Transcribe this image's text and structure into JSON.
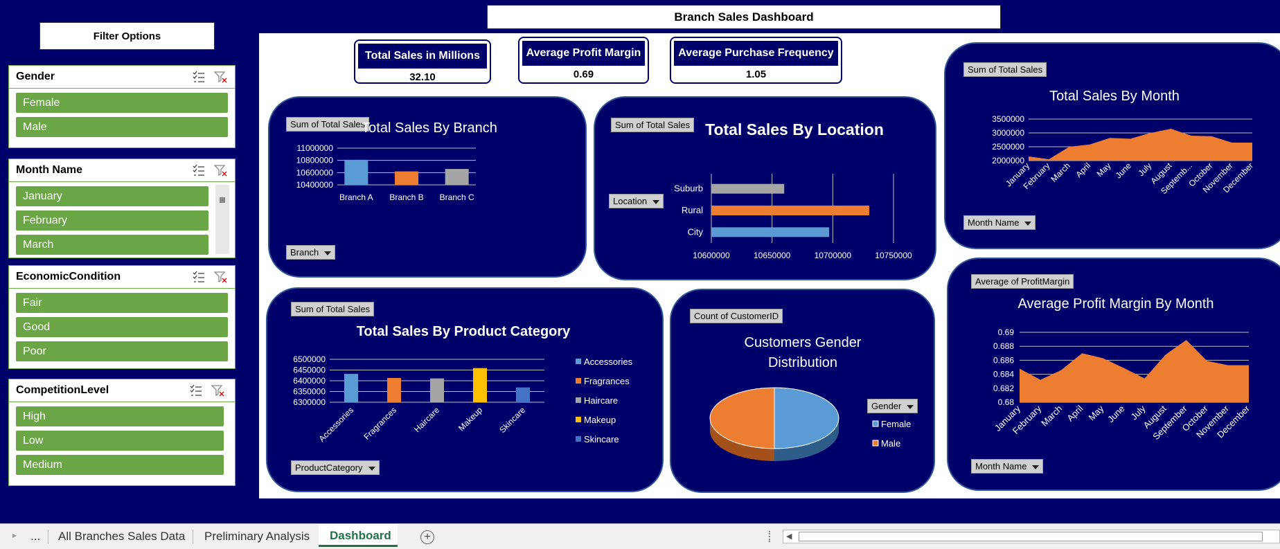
{
  "dashboard_title": "Branch Sales Dashboard",
  "filter_title": "Filter Options",
  "slicers": {
    "gender": {
      "title": "Gender",
      "items": [
        "Female",
        "Male"
      ]
    },
    "month": {
      "title": "Month Name",
      "items": [
        "January",
        "February",
        "March"
      ]
    },
    "economic": {
      "title": "EconomicCondition",
      "items": [
        "Fair",
        "Good",
        "Poor"
      ]
    },
    "competition": {
      "title": "CompetitionLevel",
      "items": [
        "High",
        "Low",
        "Medium"
      ]
    }
  },
  "kpis": [
    {
      "title": "Total Sales in Millions",
      "value": "32.10"
    },
    {
      "title": "Average Profit Margin",
      "value": "0.69"
    },
    {
      "title": "Average Purchase Frequency",
      "value": "1.05"
    }
  ],
  "field_buttons": {
    "branch_value": "Sum of Total Sales",
    "branch_axis": "Branch",
    "location_value": "Sum of Total Sales",
    "location_axis": "Location",
    "month_value": "Sum of Total Sales",
    "month_axis": "Month Name",
    "category_value": "Sum of Total Sales",
    "category_axis": "ProductCategory",
    "gender_value": "Count of CustomerID",
    "gender_axis": "Gender",
    "margin_value": "Average of ProfitMargin",
    "margin_axis": "Month Name"
  },
  "colors": {
    "navy": "#00006a",
    "blue": "#5b9bd5",
    "orange": "#ed7d31",
    "gray": "#a5a5a5",
    "yellow": "#ffc000",
    "darkblue": "#4472c4",
    "slicer_green": "#6aa645"
  },
  "tabs": {
    "ellipsis": "...",
    "items": [
      "All Branches Sales Data",
      "Preliminary Analysis",
      "Dashboard"
    ],
    "active": "Dashboard"
  },
  "chart_data": [
    {
      "id": "branch",
      "type": "bar",
      "title": "Total Sales By Branch",
      "categories": [
        "Branch A",
        "Branch B",
        "Branch C"
      ],
      "values": [
        10810000,
        10620000,
        10660000
      ],
      "colors": [
        "#5b9bd5",
        "#ed7d31",
        "#a5a5a5"
      ],
      "ylim": [
        10400000,
        11000000
      ],
      "yticks": [
        "10400000",
        "10600000",
        "10800000",
        "11000000"
      ]
    },
    {
      "id": "location",
      "type": "bar",
      "orientation": "horizontal",
      "title": "Total Sales By Location",
      "categories": [
        "Suburb",
        "Rural",
        "City"
      ],
      "values": [
        10660000,
        10730000,
        10697000
      ],
      "colors": [
        "#a5a5a5",
        "#ed7d31",
        "#5b9bd5"
      ],
      "xlim": [
        10600000,
        10750000
      ],
      "xticks": [
        "10600000",
        "10650000",
        "10700000",
        "10750000"
      ]
    },
    {
      "id": "month_sales",
      "type": "area",
      "title": "Total Sales By Month",
      "categories": [
        "January",
        "February",
        "March",
        "April",
        "May",
        "June",
        "July",
        "August",
        "September",
        "October",
        "November",
        "December"
      ],
      "tick_labels": [
        "January",
        "February",
        "March",
        "April",
        "May",
        "June",
        "July",
        "August",
        "Septemb...",
        "October",
        "November",
        "December"
      ],
      "values": [
        2150000,
        2050000,
        2500000,
        2580000,
        2820000,
        2790000,
        3000000,
        3150000,
        2900000,
        2880000,
        2650000,
        2650000
      ],
      "ylim": [
        2000000,
        3500000
      ],
      "yticks": [
        "2000000",
        "2500000",
        "3000000",
        "3500000"
      ],
      "color": "#ed7d31"
    },
    {
      "id": "category",
      "type": "bar",
      "title": "Total Sales By Product Category",
      "categories": [
        "Accessories",
        "Fragrances",
        "Haircare",
        "Makeup",
        "Skincare"
      ],
      "values": [
        6432000,
        6413000,
        6411000,
        6459000,
        6369000
      ],
      "colors": [
        "#5b9bd5",
        "#ed7d31",
        "#a5a5a5",
        "#ffc000",
        "#4472c4"
      ],
      "ylim": [
        6300000,
        6500000
      ],
      "yticks": [
        "6300000",
        "6350000",
        "6400000",
        "6450000",
        "6500000"
      ],
      "legend": [
        "Accessories",
        "Fragrances",
        "Haircare",
        "Makeup",
        "Skincare"
      ]
    },
    {
      "id": "gender",
      "type": "pie",
      "title": "Customers Gender Distribution",
      "categories": [
        "Female",
        "Male"
      ],
      "values": [
        50,
        50
      ],
      "colors": [
        "#5b9bd5",
        "#ed7d31"
      ],
      "legend": [
        "Female",
        "Male"
      ]
    },
    {
      "id": "margin",
      "type": "area",
      "title": "Average Profit Margin By Month",
      "categories": [
        "January",
        "February",
        "March",
        "April",
        "May",
        "June",
        "July",
        "August",
        "September",
        "October",
        "November",
        "December"
      ],
      "values": [
        0.6848,
        0.6832,
        0.6846,
        0.687,
        0.6863,
        0.6849,
        0.6834,
        0.6868,
        0.6889,
        0.6859,
        0.6853,
        0.6853
      ],
      "ylim": [
        0.68,
        0.69
      ],
      "yticks": [
        "0.68",
        "0.682",
        "0.684",
        "0.686",
        "0.688",
        "0.69"
      ],
      "color": "#ed7d31"
    }
  ]
}
